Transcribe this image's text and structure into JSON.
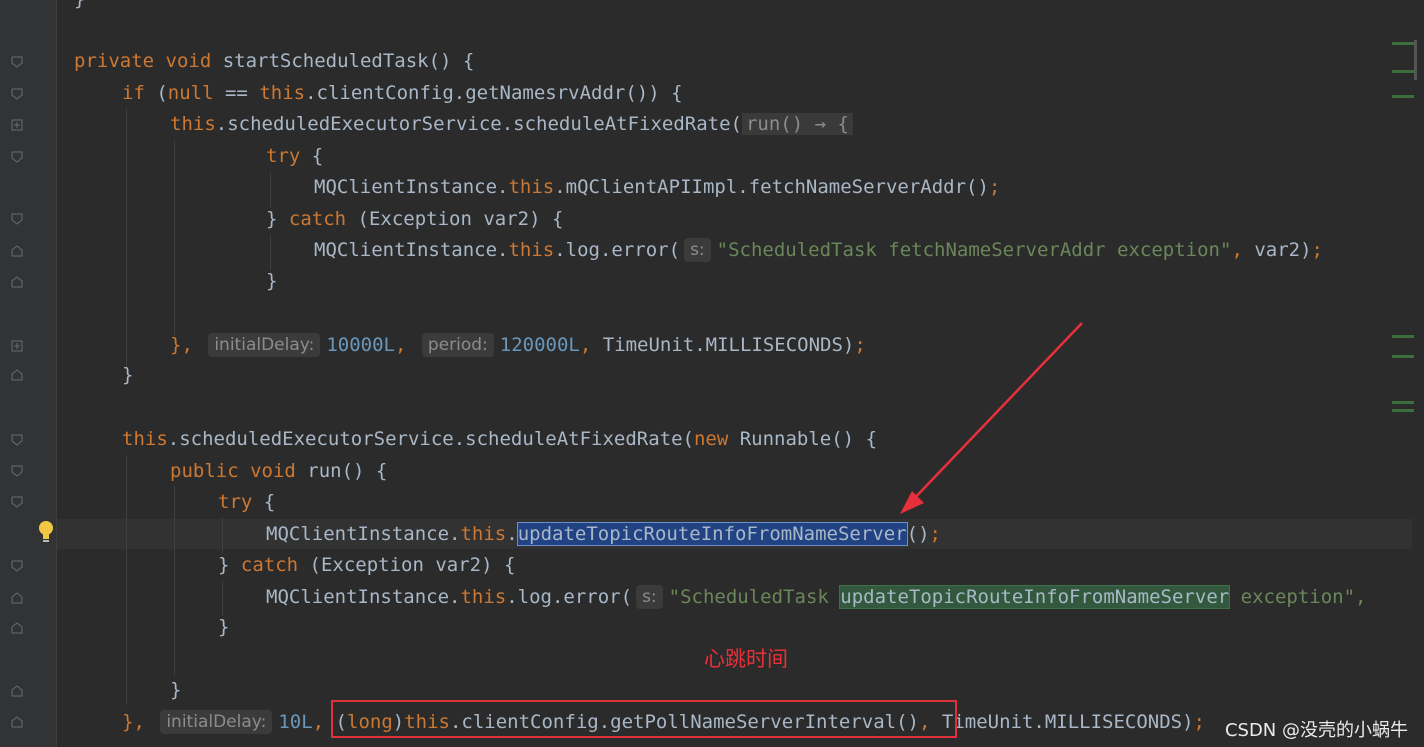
{
  "code_lines": [
    {
      "id": "l1",
      "segments": [
        {
          "t": "}",
          "c": "fn"
        }
      ]
    },
    {
      "id": "l2",
      "segments": [
        {
          "t": "private void ",
          "c": "kw"
        },
        {
          "t": "startScheduledTask() {",
          "c": "fn"
        }
      ]
    },
    {
      "id": "l3",
      "segments": [
        {
          "t": "if ",
          "c": "kw"
        },
        {
          "t": "(",
          "c": "fn"
        },
        {
          "t": "null ",
          "c": "kw"
        },
        {
          "t": "== ",
          "c": "fn"
        },
        {
          "t": "this",
          "c": "kw"
        },
        {
          "t": ".clientConfig.getNamesrvAddr()) {",
          "c": "fn"
        }
      ]
    },
    {
      "id": "l4",
      "segments": [
        {
          "t": "this",
          "c": "kw"
        },
        {
          "t": ".scheduledExecutorService.scheduleAtFixedRate(",
          "c": "fn"
        },
        {
          "t": "run() → {",
          "c": "lambda"
        }
      ]
    },
    {
      "id": "l5",
      "segments": [
        {
          "t": "try ",
          "c": "kw"
        },
        {
          "t": "{",
          "c": "fn"
        }
      ]
    },
    {
      "id": "l6",
      "segments": [
        {
          "t": "MQClientInstance.",
          "c": "fn"
        },
        {
          "t": "this",
          "c": "kw"
        },
        {
          "t": ".mQClientAPIImpl.fetchNameServerAddr()",
          "c": "fn"
        },
        {
          "t": ";",
          "c": "kw"
        }
      ]
    },
    {
      "id": "l7",
      "segments": [
        {
          "t": "} ",
          "c": "fn"
        },
        {
          "t": "catch ",
          "c": "kw"
        },
        {
          "t": "(Exception var2) {",
          "c": "fn"
        }
      ]
    },
    {
      "id": "l8",
      "segments": [
        {
          "t": "MQClientInstance.",
          "c": "fn"
        },
        {
          "t": "this",
          "c": "kw"
        },
        {
          "t": ".log.error(",
          "c": "fn"
        },
        {
          "t": "s:",
          "c": "hint"
        },
        {
          "t": "\"ScheduledTask fetchNameServerAddr exception\"",
          "c": "str"
        },
        {
          "t": ", ",
          "c": "kw"
        },
        {
          "t": "var2)",
          "c": "fn"
        },
        {
          "t": ";",
          "c": "kw"
        }
      ]
    },
    {
      "id": "l9",
      "segments": [
        {
          "t": "}",
          "c": "fn"
        }
      ]
    },
    {
      "id": "l10",
      "segments": [
        {
          "t": "}, ",
          "c": "kw"
        },
        {
          "t": "initialDelay:",
          "c": "hint"
        },
        {
          "t": "10000L",
          "c": "num"
        },
        {
          "t": ", ",
          "c": "kw"
        },
        {
          "t": "period:",
          "c": "hint"
        },
        {
          "t": "120000L",
          "c": "num"
        },
        {
          "t": ", ",
          "c": "kw"
        },
        {
          "t": "TimeUnit.MILLISECONDS)",
          "c": "fn"
        },
        {
          "t": ";",
          "c": "kw"
        }
      ]
    },
    {
      "id": "l11",
      "segments": [
        {
          "t": "}",
          "c": "fn"
        }
      ]
    },
    {
      "id": "l12",
      "segments": [
        {
          "t": "this",
          "c": "kw"
        },
        {
          "t": ".scheduledExecutorService.scheduleAtFixedRate(",
          "c": "fn"
        },
        {
          "t": "new ",
          "c": "kw"
        },
        {
          "t": "Runnable() {",
          "c": "fn"
        }
      ]
    },
    {
      "id": "l13",
      "segments": [
        {
          "t": "public void ",
          "c": "kw"
        },
        {
          "t": "run() {",
          "c": "fn"
        }
      ]
    },
    {
      "id": "l14",
      "segments": [
        {
          "t": "try ",
          "c": "kw"
        },
        {
          "t": "{",
          "c": "fn"
        }
      ]
    },
    {
      "id": "l15",
      "segments": [
        {
          "t": "MQClientInstance.",
          "c": "fn"
        },
        {
          "t": "this",
          "c": "kw"
        },
        {
          "t": ".",
          "c": "fn"
        },
        {
          "t": "updateTopicRouteInfoFromNameServer",
          "c": "sel"
        },
        {
          "t": "()",
          "c": "fn"
        },
        {
          "t": ";",
          "c": "kw"
        }
      ]
    },
    {
      "id": "l16",
      "segments": [
        {
          "t": "} ",
          "c": "fn"
        },
        {
          "t": "catch ",
          "c": "kw"
        },
        {
          "t": "(Exception var2) {",
          "c": "fn"
        }
      ]
    },
    {
      "id": "l17",
      "segments": [
        {
          "t": "MQClientInstance.",
          "c": "fn"
        },
        {
          "t": "this",
          "c": "kw"
        },
        {
          "t": ".log.error(",
          "c": "fn"
        },
        {
          "t": "s:",
          "c": "hint"
        },
        {
          "t": "\"ScheduledTask ",
          "c": "str"
        },
        {
          "t": "updateTopicRouteInfoFromNameServer",
          "c": "match"
        },
        {
          "t": " exception\",",
          "c": "str"
        }
      ]
    },
    {
      "id": "l18",
      "segments": [
        {
          "t": "}",
          "c": "fn"
        }
      ]
    },
    {
      "id": "l19",
      "segments": [
        {
          "t": "}",
          "c": "fn"
        }
      ]
    },
    {
      "id": "l20",
      "segments": [
        {
          "t": "}, ",
          "c": "kw"
        },
        {
          "t": "initialDelay:",
          "c": "hint"
        },
        {
          "t": "10L",
          "c": "num"
        },
        {
          "t": ", ",
          "c": "kw"
        },
        {
          "t": "(",
          "c": "fn"
        },
        {
          "t": "long",
          "c": "kw"
        },
        {
          "t": ")",
          "c": "fn"
        },
        {
          "t": "this",
          "c": "kw"
        },
        {
          "t": ".clientConfig.getPollNameServerInterval()",
          "c": "fn"
        },
        {
          "t": ", ",
          "c": "kw"
        },
        {
          "t": "TimeUnit.MILLISECONDS)",
          "c": "fn"
        },
        {
          "t": ";",
          "c": "kw"
        }
      ]
    }
  ],
  "annotation": {
    "text": "心跳时间"
  },
  "watermark": {
    "text": "CSDN @没壳的小蜗牛"
  },
  "colors": {
    "keyword": "#cc7832",
    "string": "#6a8759",
    "number": "#6897bb",
    "text": "#a9b7c6",
    "annotation": "#e8303a"
  }
}
